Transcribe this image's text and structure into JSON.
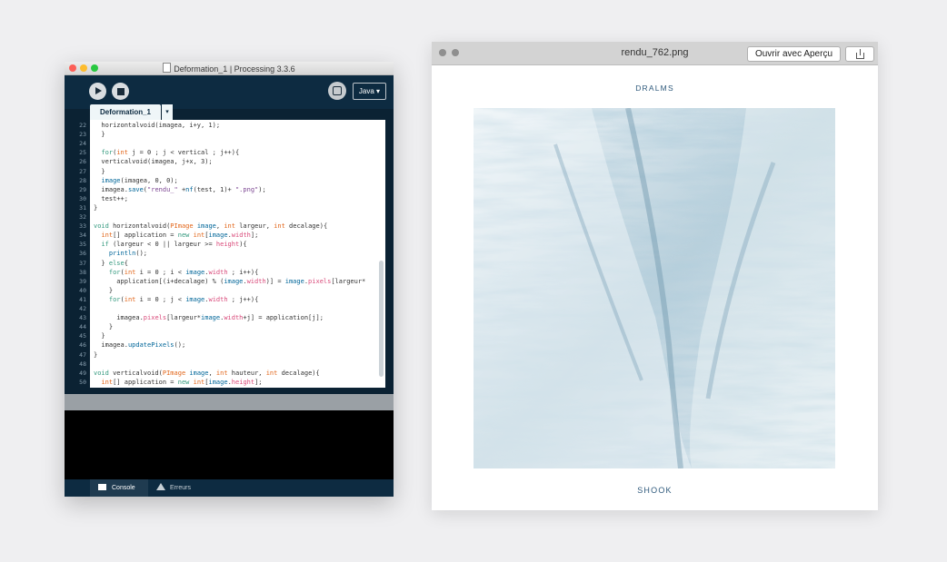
{
  "processing": {
    "window_title": "Deformation_1 | Processing 3.3.6",
    "mode_label": "Java ▾",
    "tab_label": "Deformation_1",
    "tab_arrow": "▾",
    "code_lines": [
      {
        "n": "22",
        "t": "  horizontalvoid(imagea, i+y, 1);"
      },
      {
        "n": "23",
        "t": "  }"
      },
      {
        "n": "24",
        "t": ""
      },
      {
        "n": "25",
        "t": "  for(int j = 0 ; j < vertical ; j++){"
      },
      {
        "n": "26",
        "t": "  verticalvoid(imagea, j+x, 3);"
      },
      {
        "n": "27",
        "t": "  }"
      },
      {
        "n": "28",
        "t": "  image(imagea, 0, 0);"
      },
      {
        "n": "29",
        "t": "  imagea.save(\"rendu_\" +nf(test, 1)+ \".png\");"
      },
      {
        "n": "30",
        "t": "  test++;"
      },
      {
        "n": "31",
        "t": "}"
      },
      {
        "n": "32",
        "t": ""
      },
      {
        "n": "33",
        "t": "void horizontalvoid(PImage image, int largeur, int decalage){"
      },
      {
        "n": "34",
        "t": "  int[] application = new int[image.width];"
      },
      {
        "n": "35",
        "t": "  if (largeur < 0 || largeur >= height){"
      },
      {
        "n": "36",
        "t": "    println();"
      },
      {
        "n": "37",
        "t": "  } else{"
      },
      {
        "n": "38",
        "t": "    for(int i = 0 ; i < image.width ; i++){"
      },
      {
        "n": "39",
        "t": "      application[(i+decalage) % (image.width)] = image.pixels[largeur*"
      },
      {
        "n": "40",
        "t": "    }"
      },
      {
        "n": "41",
        "t": "    for(int i = 0 ; j < image.width ; j++){"
      },
      {
        "n": "42",
        "t": ""
      },
      {
        "n": "43",
        "t": "      imagea.pixels[largeur*image.width+j] = application[j];"
      },
      {
        "n": "44",
        "t": "    }"
      },
      {
        "n": "45",
        "t": "  }"
      },
      {
        "n": "46",
        "t": "  imagea.updatePixels();"
      },
      {
        "n": "47",
        "t": "}"
      },
      {
        "n": "48",
        "t": ""
      },
      {
        "n": "49",
        "t": "void verticalvoid(PImage image, int hauteur, int decalage){"
      },
      {
        "n": "50",
        "t": "  int[] application = new int[image.height];"
      }
    ],
    "footer": {
      "console": "Console",
      "errors": "Erreurs"
    }
  },
  "preview": {
    "window_title": "rendu_762.png",
    "open_button": "Ouvrir avec Aperçu",
    "artist": "DRALMS",
    "album": "SHOOK"
  },
  "colors": {
    "editor_bg": "#0b2233",
    "accent_text": "#2f5a7c",
    "keyword": "#e2661a",
    "type": "#33997e",
    "function": "#006699"
  }
}
